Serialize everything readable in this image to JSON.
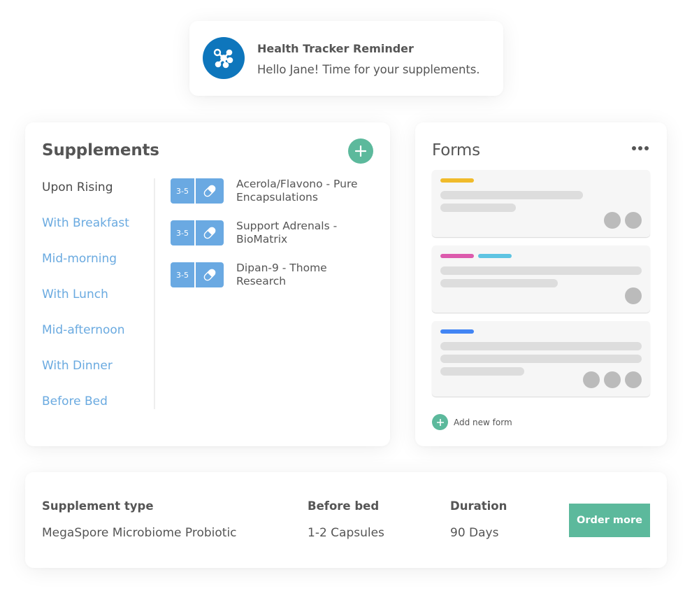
{
  "notification": {
    "icon": "molecule-icon",
    "title": "Health Tracker Reminder",
    "message": "Hello Jane! Time for your supplements."
  },
  "supplements": {
    "title": "Supplements",
    "add_icon": "plus-icon",
    "timings": [
      {
        "label": "Upon Rising",
        "active": true
      },
      {
        "label": "With Breakfast",
        "active": false
      },
      {
        "label": "Mid-morning",
        "active": false
      },
      {
        "label": "With Lunch",
        "active": false
      },
      {
        "label": "Mid-afternoon",
        "active": false
      },
      {
        "label": "With Dinner",
        "active": false
      },
      {
        "label": "Before Bed",
        "active": false
      }
    ],
    "items": [
      {
        "count": "3-5",
        "icon": "capsule-icon",
        "name": "Acerola/Flavono - Pure Encapsulations"
      },
      {
        "count": "3-5",
        "icon": "capsule-icon",
        "name": "Support Adrenals - BioMatrix"
      },
      {
        "count": "3-5",
        "icon": "capsule-icon",
        "name": "Dipan-9 - Thome Research"
      }
    ]
  },
  "forms": {
    "title": "Forms",
    "menu_icon": "more-horizontal-icon",
    "cards": [
      {
        "tags": [
          "#f0bb2b"
        ],
        "avatars": 2
      },
      {
        "tags": [
          "#dc5bad",
          "#5ec4e2"
        ],
        "avatars": 1
      },
      {
        "tags": [
          "#4285f4"
        ],
        "avatars": 3
      }
    ],
    "add_label": "Add new form"
  },
  "details": {
    "type_header": "Supplement type",
    "type_value": "MegaSpore Microbiome Probiotic",
    "timing_header": "Before bed",
    "timing_value": "1-2 Capsules",
    "duration_header": "Duration",
    "duration_value": "90 Days",
    "order_label": "Order more"
  },
  "colors": {
    "accent_green": "#5cb99c",
    "link_blue": "#6aaae0",
    "brand_blue": "#0e76bc"
  }
}
